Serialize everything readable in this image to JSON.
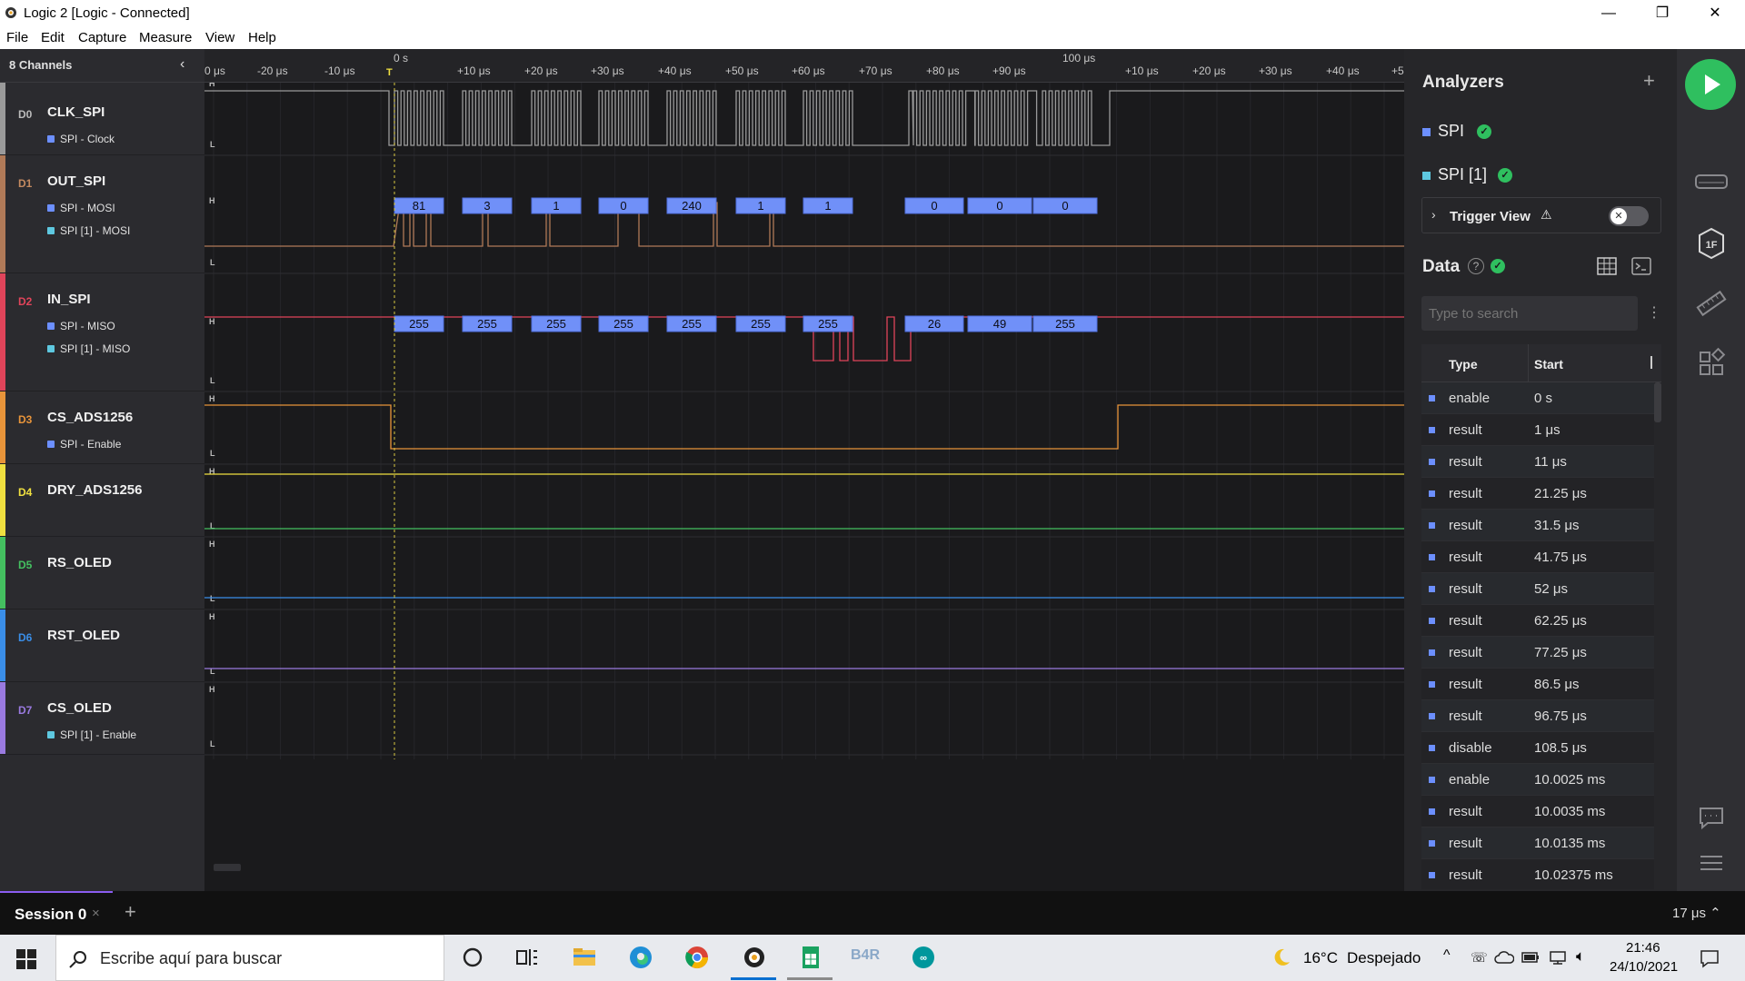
{
  "window": {
    "title": "Logic 2 [Logic - Connected]",
    "minimize": "—",
    "restore": "❐",
    "close": "✕"
  },
  "menu": [
    "File",
    "Edit",
    "Capture",
    "Measure",
    "View",
    "Help"
  ],
  "channels_header": {
    "label": "8 Channels",
    "collapse_icon": "chevron-left-icon"
  },
  "channels": [
    {
      "id": "D0",
      "name": "CLK_SPI",
      "color": "#9a9a9a",
      "subs": [
        {
          "label": "SPI - Clock",
          "color": "#6c8fff"
        }
      ]
    },
    {
      "id": "D1",
      "name": "OUT_SPI",
      "color": "#b07a58",
      "subs": [
        {
          "label": "SPI - MOSI",
          "color": "#6c8fff"
        },
        {
          "label": "SPI [1] - MOSI",
          "color": "#5ec8e0"
        }
      ]
    },
    {
      "id": "D2",
      "name": "IN_SPI",
      "color": "#e0445a",
      "subs": [
        {
          "label": "SPI - MISO",
          "color": "#6c8fff"
        },
        {
          "label": "SPI [1] - MISO",
          "color": "#5ec8e0"
        }
      ]
    },
    {
      "id": "D3",
      "name": "CS_ADS1256",
      "color": "#e8943a",
      "subs": [
        {
          "label": "SPI - Enable",
          "color": "#6c8fff"
        }
      ]
    },
    {
      "id": "D4",
      "name": "DRY_ADS1256",
      "color": "#f0e040",
      "subs": []
    },
    {
      "id": "D5",
      "name": "RS_OLED",
      "color": "#44c060",
      "subs": []
    },
    {
      "id": "D6",
      "name": "RST_OLED",
      "color": "#3a8ee8",
      "subs": []
    },
    {
      "id": "D7",
      "name": "CS_OLED",
      "color": "#9a7ae0",
      "subs": [
        {
          "label": "SPI [1] - Enable",
          "color": "#5ec8e0"
        }
      ]
    }
  ],
  "ruler": {
    "labels": [
      "0 μs",
      "-20 μs",
      "-10 μs",
      "+10 μs",
      "+20 μs",
      "+30 μs",
      "+40 μs",
      "+50 μs",
      "+60 μs",
      "+70 μs",
      "+80 μs",
      "+90 μs",
      "+10 μs",
      "+20 μs",
      "+30 μs",
      "+40 μs",
      "+5"
    ],
    "major": [
      "0 s",
      "100 μs"
    ],
    "trigger_marker": "T"
  },
  "level_labels": {
    "high": "H",
    "low": "L"
  },
  "decoded": {
    "mosi": [
      "81",
      "3",
      "1",
      "0",
      "240",
      "1",
      "1",
      "0",
      "0",
      "0"
    ],
    "miso": [
      "255",
      "255",
      "255",
      "255",
      "255",
      "255",
      "255",
      "26",
      "49",
      "255"
    ]
  },
  "analyzers": {
    "title": "Analyzers",
    "add_icon": "plus-icon",
    "items": [
      {
        "name": "SPI",
        "status": "ok"
      },
      {
        "name": "SPI [1]",
        "status": "ok"
      }
    ],
    "trigger_view": {
      "label": "Trigger View",
      "warning_icon": "warning-icon",
      "enabled": false
    }
  },
  "data_panel": {
    "title": "Data",
    "search_placeholder": "Type to search",
    "columns": [
      "Type",
      "Start"
    ],
    "rows": [
      {
        "type": "enable",
        "start": "0 s"
      },
      {
        "type": "result",
        "start": "1 μs"
      },
      {
        "type": "result",
        "start": "11 μs"
      },
      {
        "type": "result",
        "start": "21.25 μs"
      },
      {
        "type": "result",
        "start": "31.5 μs"
      },
      {
        "type": "result",
        "start": "41.75 μs"
      },
      {
        "type": "result",
        "start": "52 μs"
      },
      {
        "type": "result",
        "start": "62.25 μs"
      },
      {
        "type": "result",
        "start": "77.25 μs"
      },
      {
        "type": "result",
        "start": "86.5 μs"
      },
      {
        "type": "result",
        "start": "96.75 μs"
      },
      {
        "type": "disable",
        "start": "108.5 μs"
      },
      {
        "type": "enable",
        "start": "10.0025 ms"
      },
      {
        "type": "result",
        "start": "10.0035 ms"
      },
      {
        "type": "result",
        "start": "10.0135 ms"
      },
      {
        "type": "result",
        "start": "10.02375 ms"
      }
    ]
  },
  "session": {
    "tab": "Session 0",
    "close": "×",
    "add": "+",
    "zoom": "17 μs ⌃"
  },
  "taskbar": {
    "search_placeholder": "Escribe aquí para buscar",
    "weather_temp": "16°C",
    "weather_text": "Despejado",
    "time": "21:46",
    "date": "24/10/2021",
    "pinned": [
      "task-view-icon",
      "file-explorer-icon",
      "edge-icon",
      "chrome-icon",
      "logic2-icon",
      "sheets-icon",
      "b4r-icon",
      "arduino-icon"
    ],
    "b4r_label": "B4R"
  }
}
